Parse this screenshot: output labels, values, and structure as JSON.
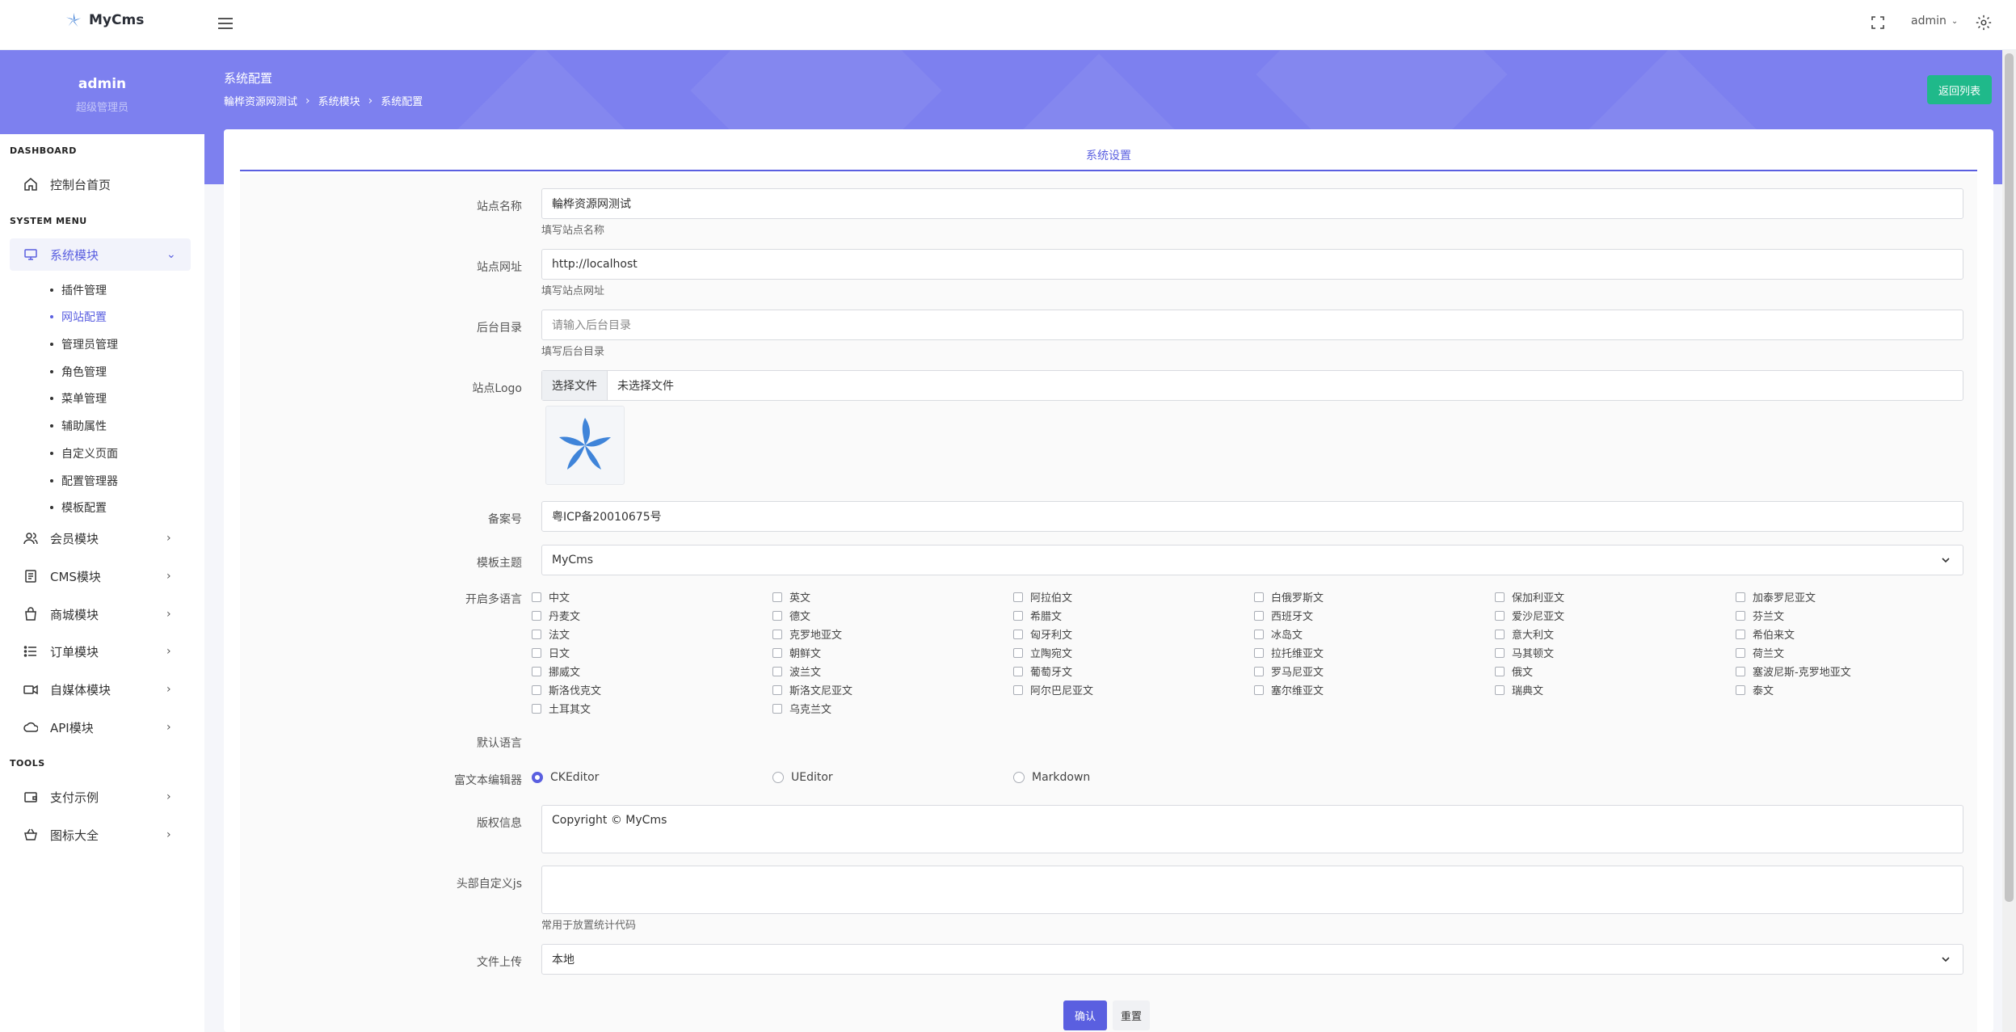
{
  "app": {
    "name": "MyCms",
    "user": "admin"
  },
  "hero": {
    "user_name": "admin",
    "user_role": "超级管理员",
    "title": "系统配置",
    "breadcrumb": [
      "輪桦资源网测试",
      "系统模块",
      "系统配置"
    ],
    "back_label": "返回列表"
  },
  "sidebar": {
    "section_dashboard": "DASHBOARD",
    "dashboard_home": "控制台首页",
    "section_system": "SYSTEM MENU",
    "system_module": "系统模块",
    "system_sub": [
      "插件管理",
      "网站配置",
      "管理员管理",
      "角色管理",
      "菜单管理",
      "辅助属性",
      "自定义页面",
      "配置管理器",
      "模板配置"
    ],
    "modules": [
      "会员模块",
      "CMS模块",
      "商城模块",
      "订单模块",
      "自媒体模块",
      "API模块"
    ],
    "section_tools": "TOOLS",
    "tools": [
      "支付示例",
      "图标大全"
    ]
  },
  "form": {
    "tab_title": "系统设置",
    "site_name": {
      "label": "站点名称",
      "value": "輪桦资源网测试",
      "hint": "填写站点名称"
    },
    "site_url": {
      "label": "站点网址",
      "value": "http://localhost",
      "hint": "填写站点网址"
    },
    "admin_dir": {
      "label": "后台目录",
      "placeholder": "请输入后台目录",
      "hint": "填写后台目录"
    },
    "site_logo": {
      "label": "站点Logo",
      "button": "选择文件",
      "status": "未选择文件"
    },
    "icp": {
      "label": "备案号",
      "value": "粤ICP备20010675号"
    },
    "theme": {
      "label": "模板主题",
      "value": "MyCms"
    },
    "multi_lang": {
      "label": "开启多语言",
      "options": [
        "中文",
        "英文",
        "阿拉伯文",
        "白俄罗斯文",
        "保加利亚文",
        "加泰罗尼亚文",
        "丹麦文",
        "德文",
        "希腊文",
        "西班牙文",
        "爱沙尼亚文",
        "芬兰文",
        "法文",
        "克罗地亚文",
        "匈牙利文",
        "冰岛文",
        "意大利文",
        "希伯来文",
        "日文",
        "朝鲜文",
        "立陶宛文",
        "拉托维亚文",
        "马其顿文",
        "荷兰文",
        "挪威文",
        "波兰文",
        "葡萄牙文",
        "罗马尼亚文",
        "俄文",
        "塞波尼斯-克罗地亚文",
        "斯洛伐克文",
        "斯洛文尼亚文",
        "阿尔巴尼亚文",
        "塞尔维亚文",
        "瑞典文",
        "泰文",
        "土耳其文",
        "乌克兰文"
      ]
    },
    "default_lang": {
      "label": "默认语言"
    },
    "editor": {
      "label": "富文本编辑器",
      "options": [
        "CKEditor",
        "UEditor",
        "Markdown"
      ],
      "selected": "CKEditor"
    },
    "copyright": {
      "label": "版权信息",
      "value": "Copyright © MyCms"
    },
    "head_js": {
      "label": "头部自定义js",
      "value": "",
      "hint": "常用于放置统计代码"
    },
    "upload": {
      "label": "文件上传",
      "value": "本地"
    },
    "confirm": "确认",
    "reset": "重置"
  },
  "colors": {
    "accent": "#5a5fe0",
    "hero": "#7d80ef",
    "success": "#1fb98a"
  }
}
